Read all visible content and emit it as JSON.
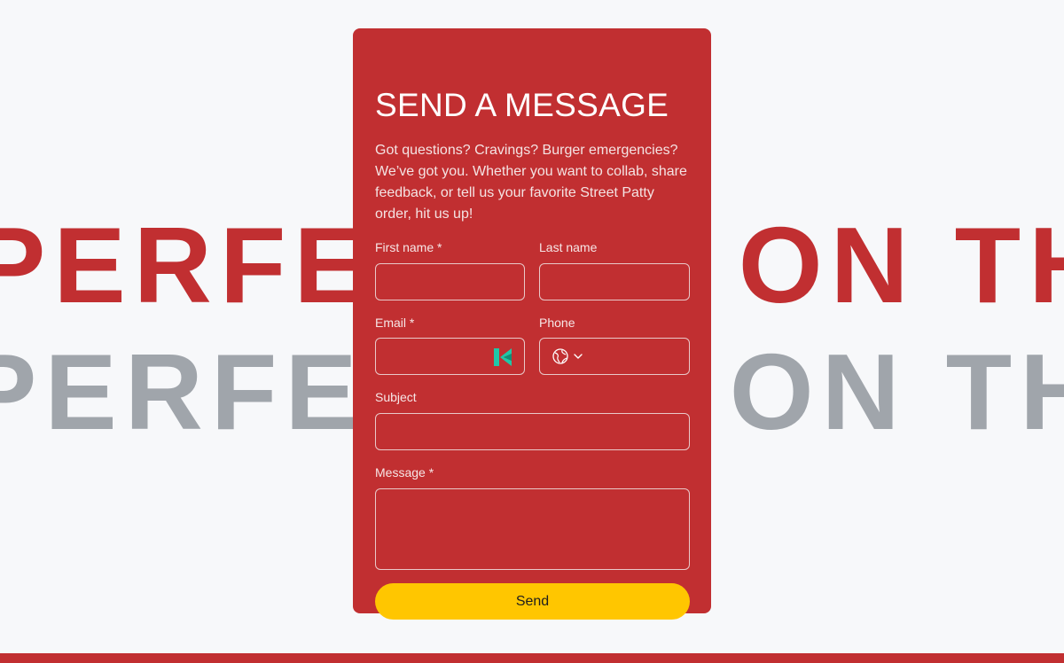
{
  "background": {
    "marquee_top": "PERFECTED ON THE PAN",
    "marquee_bottom": "PERFECTED ON THE PAN"
  },
  "form": {
    "title": "SEND A MESSAGE",
    "description": "Got questions? Cravings? Burger emergencies? We’ve got you. Whether you want to collab, share feedback, or tell us your favorite Street Patty order, hit us up!",
    "first_name": {
      "label": "First name *",
      "value": "",
      "placeholder": ""
    },
    "last_name": {
      "label": "Last name",
      "value": "",
      "placeholder": ""
    },
    "email": {
      "label": "Email *",
      "value": "",
      "placeholder": "",
      "icon": "k-autofill-icon"
    },
    "phone": {
      "label": "Phone",
      "value": "",
      "placeholder": "",
      "country_icon": "globe-icon",
      "dropdown_icon": "chevron-down-icon"
    },
    "subject": {
      "label": "Subject",
      "value": "",
      "placeholder": ""
    },
    "message": {
      "label": "Message *",
      "value": "",
      "placeholder": ""
    },
    "send_label": "Send"
  },
  "colors": {
    "brand_red": "#c12f31",
    "button_yellow": "#ffc600",
    "marquee_gray": "#a0a5ab",
    "k_icon_teal": "#1fc7a7"
  }
}
